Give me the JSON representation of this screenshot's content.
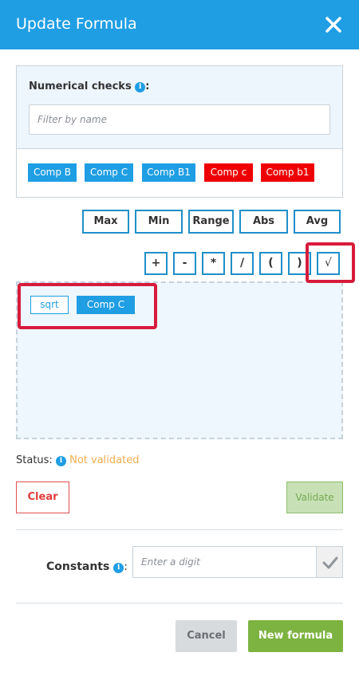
{
  "header": {
    "title": "Update Formula",
    "close_icon": "close-icon"
  },
  "numerical_checks": {
    "label": "Numerical checks",
    "label_suffix": ":",
    "filter_placeholder": "Filter by name",
    "items": [
      {
        "label": "Comp B",
        "color": "#1f9ee4"
      },
      {
        "label": "Comp C",
        "color": "#1f9ee4"
      },
      {
        "label": "Comp B1",
        "color": "#1f9ee4"
      },
      {
        "label": "Comp c",
        "color": "#ee0000"
      },
      {
        "label": "Comp b1",
        "color": "#ee0000"
      }
    ]
  },
  "functions": [
    "Max",
    "Min",
    "Range",
    "Abs",
    "Avg"
  ],
  "operators": [
    "+",
    "-",
    "*",
    "/",
    "(",
    ")",
    "√"
  ],
  "formula": {
    "tokens": [
      {
        "type": "function",
        "label": "sqrt"
      },
      {
        "type": "check",
        "label": "Comp C"
      }
    ]
  },
  "status": {
    "label": "Status:",
    "value": "Not validated",
    "value_color": "#f0ad4e"
  },
  "buttons": {
    "clear": "Clear",
    "validate": "Validate",
    "cancel": "Cancel",
    "new_formula": "New formula"
  },
  "constants": {
    "label": "Constants",
    "label_suffix": ":",
    "placeholder": "Enter a digit"
  },
  "colors": {
    "header": "#1f9ee4",
    "accent": "#1f9ee4",
    "highlight": "#d81b3c",
    "success": "#7db341",
    "danger": "#e03c3c"
  }
}
